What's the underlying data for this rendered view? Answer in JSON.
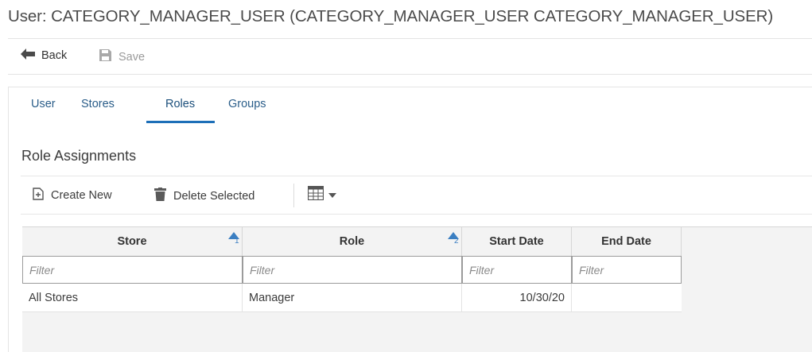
{
  "page": {
    "title": "User: CATEGORY_MANAGER_USER (CATEGORY_MANAGER_USER CATEGORY_MANAGER_USER)"
  },
  "toolbar": {
    "back_label": "Back",
    "save_label": "Save",
    "back_icon": "arrow-left-icon",
    "save_icon": "floppy-disk-icon"
  },
  "tabs": [
    {
      "label": "User"
    },
    {
      "label": "Stores"
    },
    {
      "label": "Roles",
      "active": true
    },
    {
      "label": "Groups"
    }
  ],
  "section": {
    "title": "Role Assignments"
  },
  "table_toolbar": {
    "create_label": "Create New",
    "delete_label": "Delete Selected",
    "create_icon": "add-document-icon",
    "delete_icon": "trash-icon",
    "columns_icon": "table-grid-icon"
  },
  "grid": {
    "columns": [
      {
        "label": "Store",
        "sort_order": "1"
      },
      {
        "label": "Role",
        "sort_order": "2"
      },
      {
        "label": "Start Date"
      },
      {
        "label": "End Date"
      }
    ],
    "filter_placeholder": "Filter",
    "rows": [
      {
        "store": "All Stores",
        "role": "Manager",
        "start_date": "10/30/20",
        "end_date": ""
      }
    ]
  },
  "colors": {
    "accent": "#1d6fb8",
    "tab_text": "#2a5d89",
    "sort_indicator": "#3b7fc2"
  }
}
